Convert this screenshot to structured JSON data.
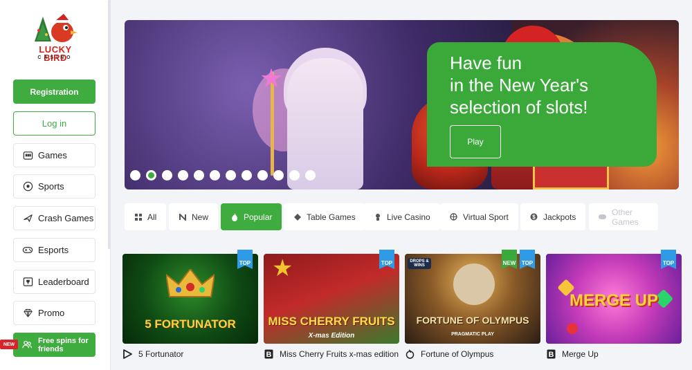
{
  "logo": {
    "line1": "LUCKY BIRD",
    "line2": "CASINO"
  },
  "sidebar": {
    "registration": "Registration",
    "login": "Log in",
    "items": [
      {
        "label": "Games",
        "icon": "slot-machine-icon"
      },
      {
        "label": "Sports",
        "icon": "soccer-ball-icon"
      },
      {
        "label": "Crash Games",
        "icon": "plane-icon"
      },
      {
        "label": "Esports",
        "icon": "gamepad-icon"
      },
      {
        "label": "Leaderboard",
        "icon": "trophy-board-icon"
      },
      {
        "label": "Promo",
        "icon": "diamond-icon"
      }
    ],
    "free_spins": "Free spins for friends",
    "new_badge": "NEW"
  },
  "banner": {
    "headline_line1": "Have fun",
    "headline_line2": "in the New Year's",
    "headline_line3": "selection of slots!",
    "play_label": "Play",
    "slide_count": 12,
    "active_slide": 2
  },
  "tabs": [
    {
      "label": "All",
      "icon": "grid-icon",
      "active": false
    },
    {
      "label": "New",
      "icon": "new-icon",
      "active": false
    },
    {
      "label": "Popular",
      "icon": "flame-icon",
      "active": true
    },
    {
      "label": "Table Games",
      "icon": "diamond-card-icon",
      "active": false
    },
    {
      "label": "Live Casino",
      "icon": "dealer-icon",
      "active": false
    },
    {
      "label": "Virtual Sport",
      "icon": "ball-icon",
      "active": false
    },
    {
      "label": "Jackpots",
      "icon": "coin-icon",
      "active": false
    },
    {
      "label": "Other Games",
      "icon": "controller-icon",
      "active": false
    }
  ],
  "games": [
    {
      "name": "5 Fortunator",
      "art_title": "5 FORTUNATOR",
      "badges": [
        "TOP"
      ],
      "provider_icon": "play-provider-icon"
    },
    {
      "name": "Miss Cherry Fruits x-mas edition",
      "art_title": "MISS CHERRY FRUITS",
      "art_subtitle": "X-mas Edition",
      "badges": [
        "TOP"
      ],
      "provider_icon": "b-provider-icon"
    },
    {
      "name": "Fortune of Olympus",
      "art_title": "FORTUNE OF OLYMPUS",
      "art_subtitle": "PRAGMATIC PLAY",
      "badges": [
        "NEW",
        "TOP"
      ],
      "provider_icon": "pragmatic-provider-icon",
      "tag": "DROPS & WINS"
    },
    {
      "name": "Merge Up",
      "art_title": "MERGE UP",
      "badges": [
        "TOP"
      ],
      "provider_icon": "b-provider-icon"
    }
  ]
}
